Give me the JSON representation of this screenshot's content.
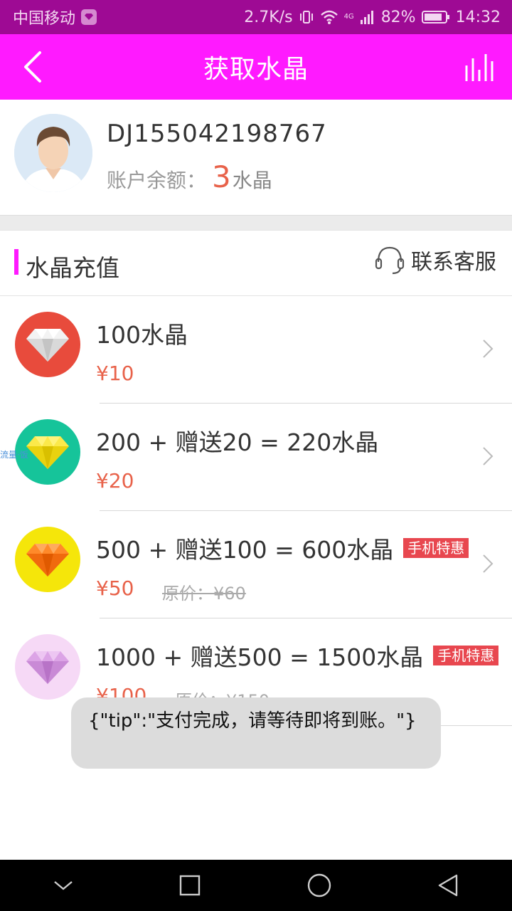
{
  "status": {
    "carrier": "中国移动",
    "speed": "2.7K/s",
    "battery": "82%",
    "time": "14:32",
    "network": "4G"
  },
  "header": {
    "title": "获取水晶",
    "bg_color": "#ff1aff"
  },
  "profile": {
    "account_id": "DJ155042198767",
    "balance_label": "账户余额：",
    "balance_value": "3",
    "balance_unit": "水晶"
  },
  "section": {
    "title": "水晶充值",
    "service_label": "联系客服"
  },
  "items": [
    {
      "name": "100水晶",
      "price": "¥10",
      "original": "",
      "tag": "",
      "gem_color": "#e84b3c"
    },
    {
      "name": "200 + 赠送20 = 220水晶",
      "price": "¥20",
      "original": "",
      "tag": "",
      "gem_color": "#16c49a"
    },
    {
      "name": "500 + 赠送100 = 600水晶",
      "price": "¥50",
      "original": "原价：¥60",
      "tag": "手机特惠",
      "gem_color": "#f5e60a"
    },
    {
      "name": "1000 + 赠送500 = 1500水晶",
      "price": "¥100",
      "original": "原价：¥150",
      "tag": "手机特惠",
      "gem_color": "#f6d9f6"
    }
  ],
  "watermark": "流量·饭",
  "toast": "{\"tip\":\"支付完成，请等待即将到账。\"}",
  "colors": {
    "status_bar": "#9e0a94",
    "accent": "#ff1aff",
    "price": "#e8624a",
    "tag": "#e8474f"
  }
}
